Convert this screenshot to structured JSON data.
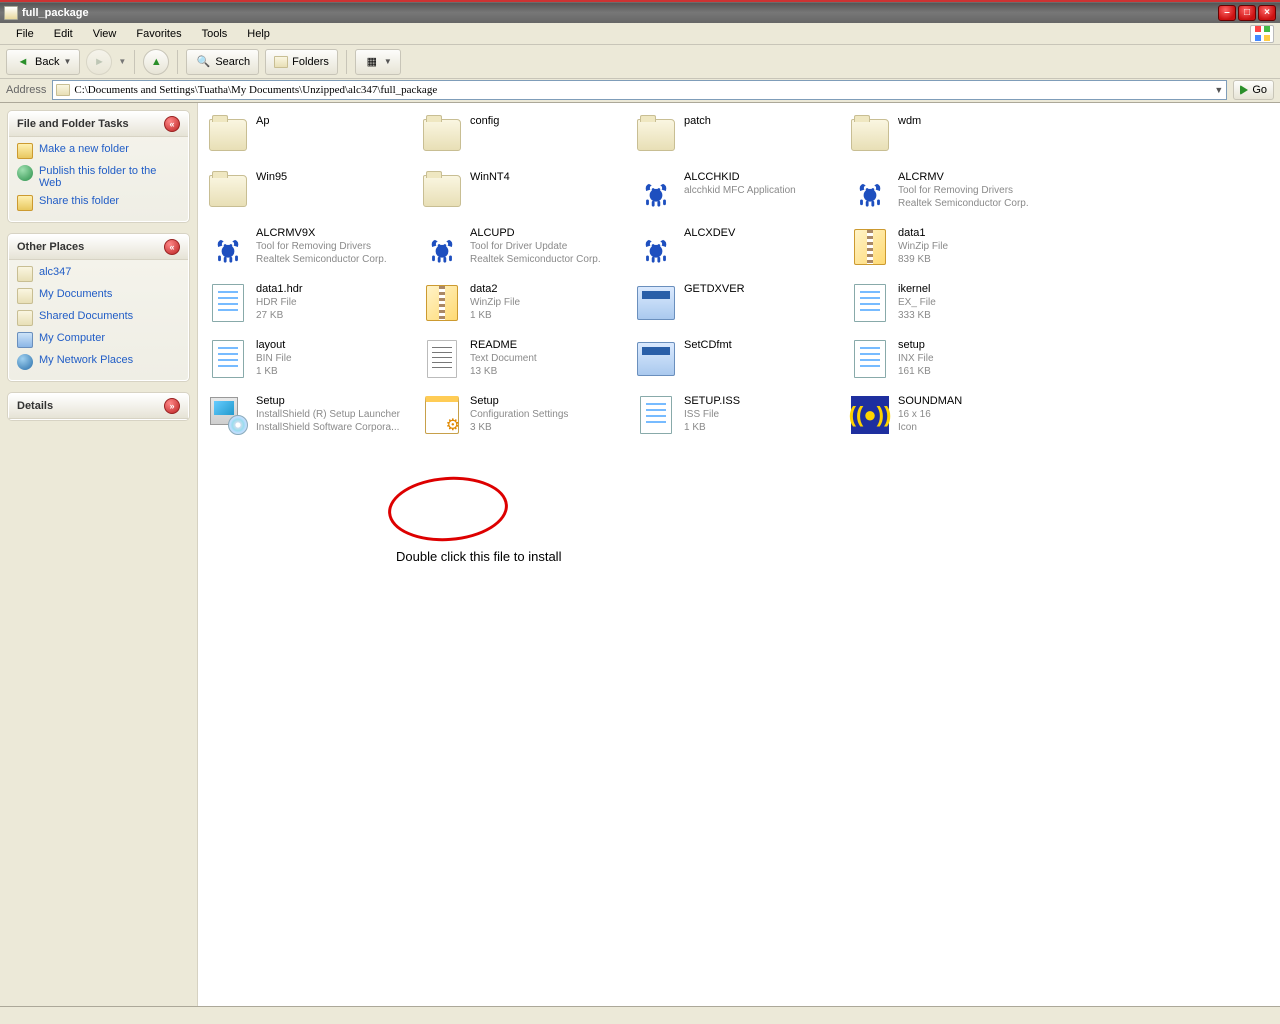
{
  "window": {
    "title": "full_package"
  },
  "menu": {
    "file": "File",
    "edit": "Edit",
    "view": "View",
    "favorites": "Favorites",
    "tools": "Tools",
    "help": "Help"
  },
  "toolbar": {
    "back": "Back",
    "search": "Search",
    "folders": "Folders"
  },
  "address": {
    "label": "Address",
    "path": "C:\\Documents and Settings\\Tuatha\\My Documents\\Unzipped\\alc347\\full_package",
    "go": "Go"
  },
  "tasks": {
    "file_folder_tasks": "File and Folder Tasks",
    "make_new_folder": "Make a new folder",
    "publish_web": "Publish this folder to the Web",
    "share_folder": "Share this folder",
    "other_places": "Other Places",
    "op_alc347": "alc347",
    "op_my_documents": "My Documents",
    "op_shared_documents": "Shared Documents",
    "op_my_computer": "My Computer",
    "op_my_network": "My Network Places",
    "details": "Details"
  },
  "files": [
    {
      "name": "Ap",
      "type": "folder"
    },
    {
      "name": "config",
      "type": "folder"
    },
    {
      "name": "patch",
      "type": "folder"
    },
    {
      "name": "wdm",
      "type": "folder"
    },
    {
      "name": "Win95",
      "type": "folder"
    },
    {
      "name": "WinNT4",
      "type": "folder"
    },
    {
      "name": "ALCCHKID",
      "type": "crab",
      "meta1": "alcchkid MFC Application"
    },
    {
      "name": "ALCRMV",
      "type": "crab",
      "meta1": "Tool for Removing Drivers",
      "meta2": "Realtek Semiconductor Corp."
    },
    {
      "name": "ALCRMV9X",
      "type": "crab",
      "meta1": "Tool for Removing Drivers",
      "meta2": "Realtek Semiconductor Corp."
    },
    {
      "name": "ALCUPD",
      "type": "crab",
      "meta1": "Tool for Driver Update",
      "meta2": "Realtek Semiconductor Corp."
    },
    {
      "name": "ALCXDEV",
      "type": "crab"
    },
    {
      "name": "data1",
      "type": "zip",
      "meta1": "WinZip File",
      "meta2": "839 KB"
    },
    {
      "name": "data1.hdr",
      "type": "doc",
      "meta1": "HDR File",
      "meta2": "27 KB"
    },
    {
      "name": "data2",
      "type": "zip",
      "meta1": "WinZip File",
      "meta2": "1 KB"
    },
    {
      "name": "GETDXVER",
      "type": "exe"
    },
    {
      "name": "ikernel",
      "type": "doc",
      "meta1": "EX_ File",
      "meta2": "333 KB"
    },
    {
      "name": "layout",
      "type": "doc",
      "meta1": "BIN File",
      "meta2": "1 KB"
    },
    {
      "name": "README",
      "type": "txt",
      "meta1": "Text Document",
      "meta2": "13 KB"
    },
    {
      "name": "SetCDfmt",
      "type": "exe"
    },
    {
      "name": "setup",
      "type": "doc",
      "meta1": "INX File",
      "meta2": "161 KB"
    },
    {
      "name": "Setup",
      "type": "setup",
      "meta1": "InstallShield (R) Setup Launcher",
      "meta2": "InstallShield Software Corpora..."
    },
    {
      "name": "Setup",
      "type": "cfg",
      "meta1": "Configuration Settings",
      "meta2": "3 KB"
    },
    {
      "name": "SETUP.ISS",
      "type": "doc",
      "meta1": "ISS File",
      "meta2": "1 KB"
    },
    {
      "name": "SOUNDMAN",
      "type": "speaker",
      "meta1": "16 x 16",
      "meta2": "Icon"
    }
  ],
  "annotation": "Double click this file to install"
}
